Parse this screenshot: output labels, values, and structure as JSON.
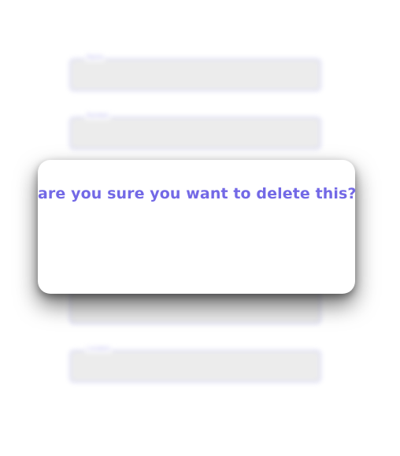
{
  "colors": {
    "accent": "#7369e6",
    "field_fill": "#ececec",
    "field_border": "#d9d9f6",
    "modal_background": "#ffffff"
  },
  "background_form": {
    "fields": [
      {
        "label": "Name"
      },
      {
        "label": "Number"
      },
      {
        "label": ""
      },
      {
        "label": "Location"
      }
    ]
  },
  "dialog": {
    "message": "are you sure you want to delete this?"
  }
}
